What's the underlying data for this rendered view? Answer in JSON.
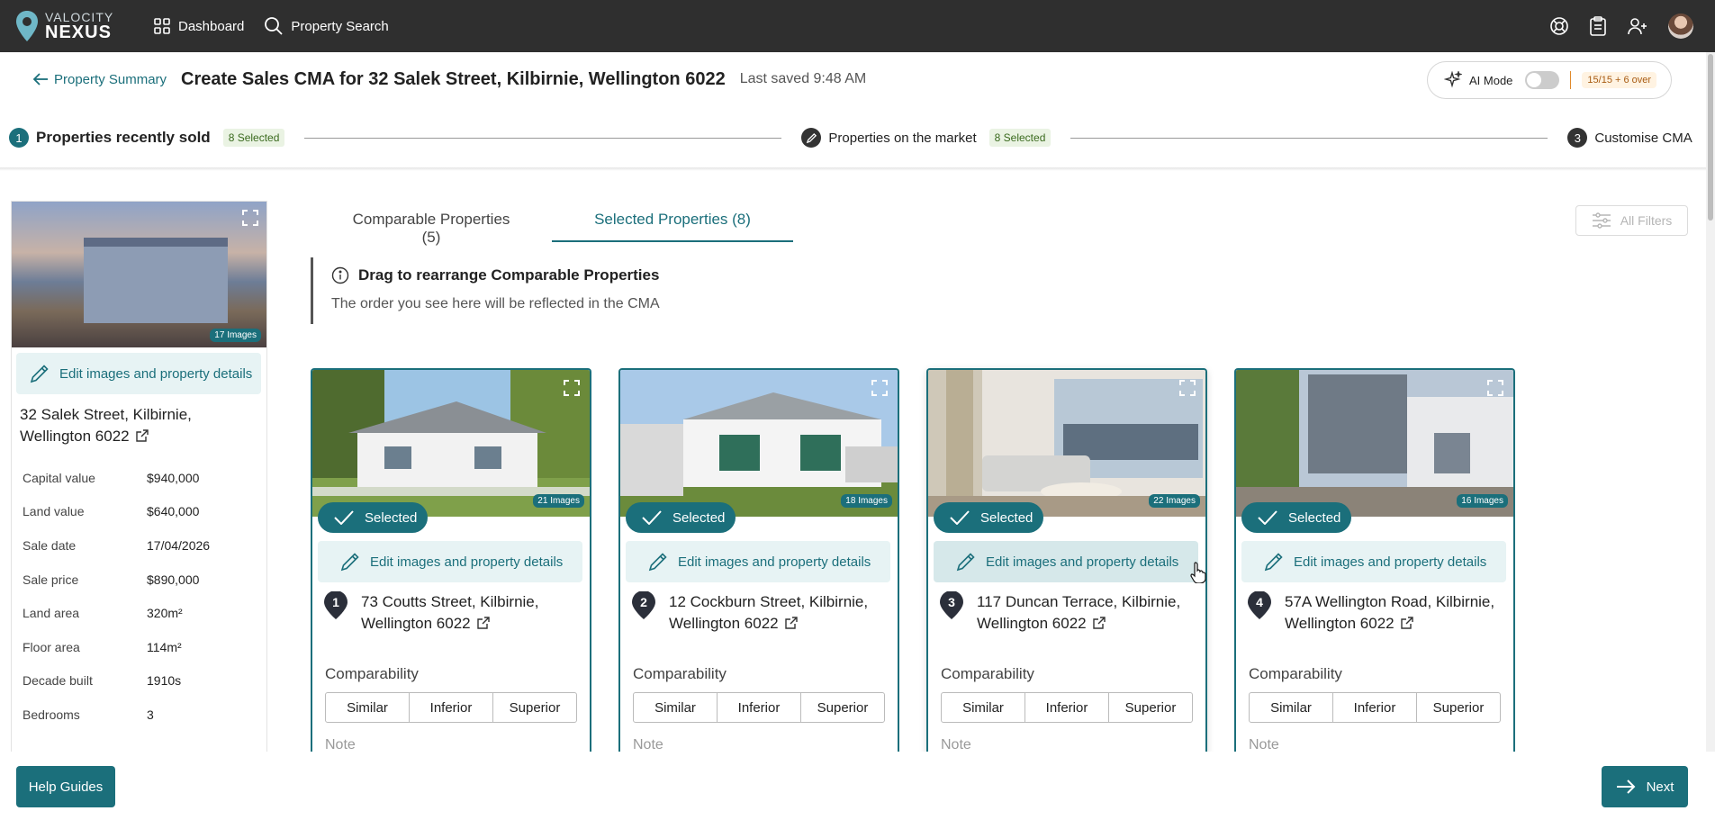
{
  "nav": {
    "logo_top": "VALOCITY",
    "logo_bottom": "NEXUS",
    "dashboard": "Dashboard",
    "property_search": "Property Search"
  },
  "header": {
    "back_label": "Property Summary",
    "title": "Create Sales CMA for 32 Salek Street, Kilbirnie, Wellington 6022",
    "last_saved": "Last saved 9:48 AM",
    "ai_mode_label": "AI Mode",
    "quota": "15/15 + 6 over"
  },
  "stepper": {
    "steps": [
      {
        "num": "1",
        "label": "Properties recently sold",
        "badge": "8 Selected"
      },
      {
        "label": "Properties on the market",
        "badge": "8 Selected"
      },
      {
        "num": "3",
        "label": "Customise CMA"
      }
    ]
  },
  "subject": {
    "images": "17 Images",
    "edit_label": "Edit images and property details",
    "address_line1": "32 Salek Street, Kilbirnie,",
    "address_line2": "Wellington 6022",
    "details": [
      {
        "k": "Capital value",
        "v": "$940,000"
      },
      {
        "k": "Land value",
        "v": "$640,000"
      },
      {
        "k": "Sale date",
        "v": "17/04/2026"
      },
      {
        "k": "Sale price",
        "v": "$890,000"
      },
      {
        "k": "Land area",
        "v": "320m²"
      },
      {
        "k": "Floor area",
        "v": "114m²"
      },
      {
        "k": "Decade built",
        "v": "1910s"
      },
      {
        "k": "Bedrooms",
        "v": "3"
      }
    ]
  },
  "tabs": [
    {
      "label": "Comparable Properties (5)"
    },
    {
      "label": "Selected Properties (8)"
    }
  ],
  "filters_label": "All Filters",
  "info": {
    "title": "Drag to rearrange Comparable Properties",
    "subtitle": "The order you see here will be reflected in the CMA"
  },
  "card_common": {
    "selected": "Selected",
    "edit_label": "Edit images and property details",
    "comparability": "Comparability",
    "options": [
      "Similar",
      "Inferior",
      "Superior"
    ],
    "note": "Note"
  },
  "cards": [
    {
      "num": "1",
      "images": "21 Images",
      "line1": "73 Coutts Street, Kilbirnie,",
      "line2": "Wellington 6022"
    },
    {
      "num": "2",
      "images": "18 Images",
      "line1": "12 Cockburn Street, Kilbirnie,",
      "line2": "Wellington 6022"
    },
    {
      "num": "3",
      "images": "22 Images",
      "line1": "117 Duncan Terrace, Kilbirnie,",
      "line2": "Wellington 6022"
    },
    {
      "num": "4",
      "images": "16 Images",
      "line1": "57A Wellington Road, Kilbirnie,",
      "line2": "Wellington 6022"
    }
  ],
  "bottom": {
    "help": "Help Guides",
    "next": "Next"
  },
  "colors": {
    "brand": "#1b6f7b",
    "nav_bg": "#2f2f2f",
    "badge_bg": "#eaf3e3"
  }
}
